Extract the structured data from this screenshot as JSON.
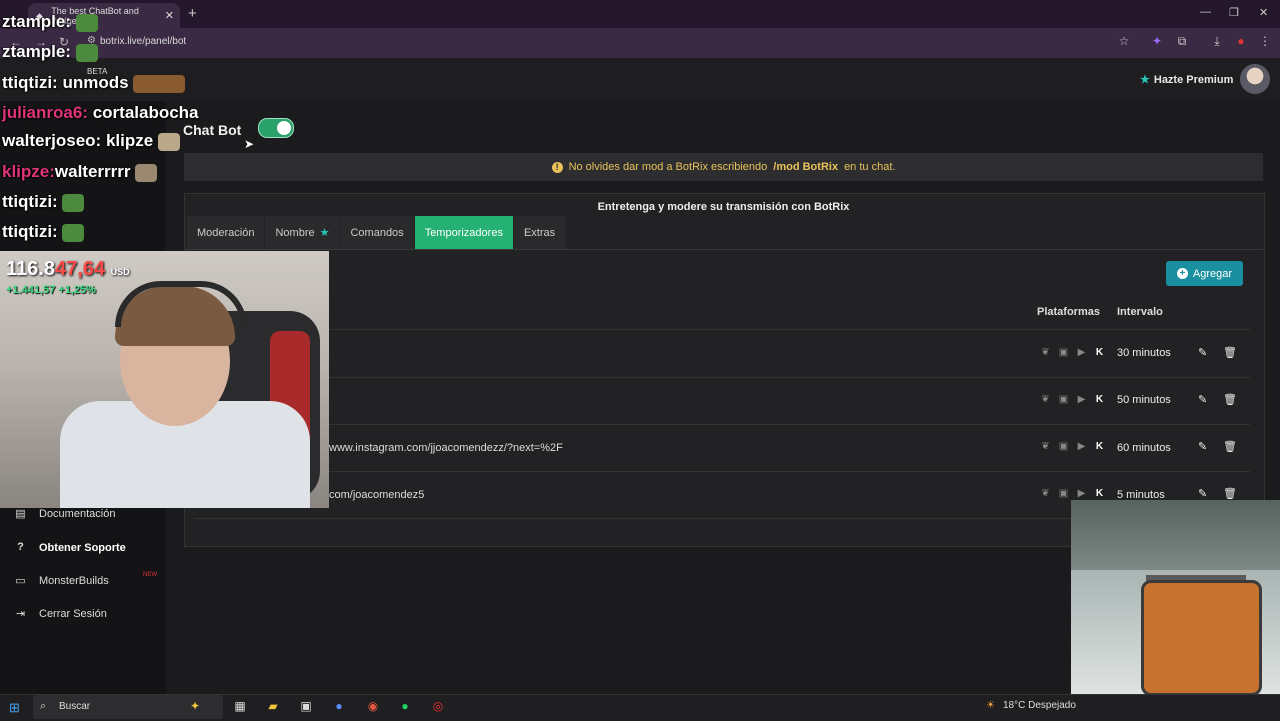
{
  "browser": {
    "tab_title": "The best ChatBot and Widgets",
    "new_tab_symbol": "+",
    "url": "botrix.live/panel/bot",
    "window_controls": [
      "—",
      "❐",
      "✕"
    ]
  },
  "header": {
    "premium_label": "Hazte Premium"
  },
  "page": {
    "title": "Chat Bot",
    "toggle_on": true,
    "notice_prefix": "No olvides dar mod a BotRix escribiendo",
    "notice_command": "/mod BotRix",
    "notice_suffix": "en tu chat.",
    "card_title": "Entretenga y modere su transmisión con BotRix",
    "tabs": [
      {
        "label": "Moderación",
        "active": false
      },
      {
        "label": "Nombre",
        "active": false,
        "star": true
      },
      {
        "label": "Comandos",
        "active": false
      },
      {
        "label": "Temporizadores",
        "active": true
      },
      {
        "label": "Extras",
        "active": false
      }
    ],
    "add_button_label": "Agregar",
    "columns": {
      "platforms": "Plataformas",
      "interval": "Intervalo"
    },
    "rows": [
      {
        "text": "",
        "interval": "30 minutos"
      },
      {
        "text": "",
        "interval": "50 minutos"
      },
      {
        "text": "www.instagram.com/jjoacomendezz/?next=%2F",
        "interval": "60 minutos"
      },
      {
        "text": "com/joacomendez5",
        "interval": "5 minutos"
      }
    ]
  },
  "sidebar": {
    "items": [
      {
        "label": "Documentación",
        "icon": "book-icon",
        "bold": false
      },
      {
        "label": "Obtener Soporte",
        "icon": "question-icon",
        "bold": true
      },
      {
        "label": "MonsterBuilds",
        "icon": "monitor-icon",
        "bold": false
      },
      {
        "label": "Cerrar Sesión",
        "icon": "logout-icon",
        "bold": false
      }
    ],
    "monster_badge": "NEW",
    "beta_badge": "BETA"
  },
  "overlay": {
    "chat": [
      {
        "user": "ztample:",
        "msg": ""
      },
      {
        "user": "ztample:",
        "msg": ""
      },
      {
        "user": "ttiqtizi:",
        "msg": "unmods"
      },
      {
        "user": "julianroa6:",
        "msg": "cortalabocha"
      },
      {
        "user": "walterjoseo:",
        "msg": "klipze"
      },
      {
        "user": "klipze:",
        "msg": "walterrrrr"
      },
      {
        "user": "ttiqtizi:",
        "msg": ""
      },
      {
        "user": "ttiqtizi:",
        "msg": ""
      }
    ],
    "stock_price_white": "116.8",
    "stock_price_red": "47,64",
    "stock_currency": "USD",
    "stock_change": "+1.441,57  +1,25%"
  },
  "taskbar": {
    "search_label": "Buscar",
    "weather_temp": "18°C",
    "weather_desc": "Despejado"
  },
  "colors": {
    "accent_green": "#25b173",
    "accent_teal": "#1a8fa0",
    "notice_yellow": "#e8c35a",
    "stock_red": "#ff4a4a",
    "stock_green": "#3ddc84"
  }
}
